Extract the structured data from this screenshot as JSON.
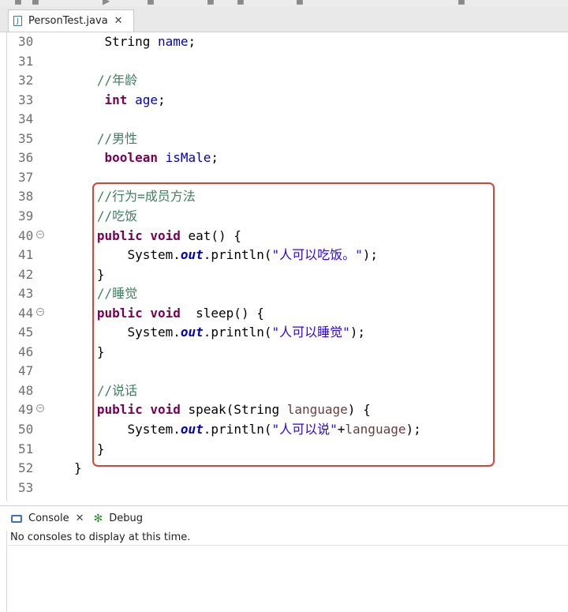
{
  "editor": {
    "tab": {
      "title": "PersonTest.java",
      "close": "✕"
    },
    "lines": [
      {
        "num": "30",
        "fold": false,
        "indent": "    ",
        "tokens": [
          {
            "t": "String "
          },
          {
            "t": "name",
            "c": "id"
          },
          {
            "t": ";"
          }
        ]
      },
      {
        "num": "31",
        "fold": false,
        "indent": "",
        "tokens": []
      },
      {
        "num": "32",
        "fold": false,
        "indent": "   ",
        "tokens": [
          {
            "t": "//年龄",
            "c": "cm"
          }
        ]
      },
      {
        "num": "33",
        "fold": false,
        "indent": "    ",
        "tokens": [
          {
            "t": "int",
            "c": "kw"
          },
          {
            "t": " "
          },
          {
            "t": "age",
            "c": "id"
          },
          {
            "t": ";"
          }
        ]
      },
      {
        "num": "34",
        "fold": false,
        "indent": "",
        "tokens": []
      },
      {
        "num": "35",
        "fold": false,
        "indent": "   ",
        "tokens": [
          {
            "t": "//男性",
            "c": "cm"
          }
        ]
      },
      {
        "num": "36",
        "fold": false,
        "indent": "    ",
        "tokens": [
          {
            "t": "boolean",
            "c": "kw"
          },
          {
            "t": " "
          },
          {
            "t": "isMale",
            "c": "id"
          },
          {
            "t": ";"
          }
        ]
      },
      {
        "num": "37",
        "fold": false,
        "indent": "",
        "tokens": []
      },
      {
        "num": "38",
        "fold": false,
        "indent": "   ",
        "tokens": [
          {
            "t": "//行为=成员方法",
            "c": "cm"
          }
        ]
      },
      {
        "num": "39",
        "fold": false,
        "indent": "   ",
        "tokens": [
          {
            "t": "//吃饭",
            "c": "cm"
          }
        ]
      },
      {
        "num": "40",
        "fold": true,
        "indent": "   ",
        "tokens": [
          {
            "t": "public",
            "c": "kw"
          },
          {
            "t": " "
          },
          {
            "t": "void",
            "c": "kw"
          },
          {
            "t": " eat() {"
          }
        ]
      },
      {
        "num": "41",
        "fold": false,
        "indent": "       ",
        "tokens": [
          {
            "t": "System."
          },
          {
            "t": "out",
            "c": "it"
          },
          {
            "t": ".println("
          },
          {
            "t": "\"人可以吃饭。\"",
            "c": "st"
          },
          {
            "t": ");"
          }
        ]
      },
      {
        "num": "42",
        "fold": false,
        "indent": "   ",
        "tokens": [
          {
            "t": "}"
          }
        ]
      },
      {
        "num": "43",
        "fold": false,
        "indent": "   ",
        "tokens": [
          {
            "t": "//睡觉",
            "c": "cm"
          }
        ]
      },
      {
        "num": "44",
        "fold": true,
        "indent": "   ",
        "tokens": [
          {
            "t": "public",
            "c": "kw"
          },
          {
            "t": " "
          },
          {
            "t": "void",
            "c": "kw"
          },
          {
            "t": "  sleep() {"
          }
        ]
      },
      {
        "num": "45",
        "fold": false,
        "indent": "       ",
        "tokens": [
          {
            "t": "System."
          },
          {
            "t": "out",
            "c": "it"
          },
          {
            "t": ".println("
          },
          {
            "t": "\"人可以睡觉\"",
            "c": "st"
          },
          {
            "t": ");"
          }
        ]
      },
      {
        "num": "46",
        "fold": false,
        "indent": "   ",
        "tokens": [
          {
            "t": "}"
          }
        ]
      },
      {
        "num": "47",
        "fold": false,
        "indent": "",
        "tokens": []
      },
      {
        "num": "48",
        "fold": false,
        "indent": "   ",
        "tokens": [
          {
            "t": "//说话",
            "c": "cm"
          }
        ]
      },
      {
        "num": "49",
        "fold": true,
        "indent": "   ",
        "tokens": [
          {
            "t": "public",
            "c": "kw"
          },
          {
            "t": " "
          },
          {
            "t": "void",
            "c": "kw"
          },
          {
            "t": " speak(String "
          },
          {
            "t": "language",
            "c": "pm"
          },
          {
            "t": ") {"
          }
        ]
      },
      {
        "num": "50",
        "fold": false,
        "indent": "       ",
        "tokens": [
          {
            "t": "System."
          },
          {
            "t": "out",
            "c": "it"
          },
          {
            "t": ".println("
          },
          {
            "t": "\"人可以说\"",
            "c": "st"
          },
          {
            "t": "+"
          },
          {
            "t": "language",
            "c": "pm"
          },
          {
            "t": ");"
          }
        ]
      },
      {
        "num": "51",
        "fold": false,
        "indent": "   ",
        "tokens": [
          {
            "t": "}"
          }
        ]
      },
      {
        "num": "52",
        "fold": false,
        "indent": "",
        "tokens": [
          {
            "t": "}"
          }
        ]
      },
      {
        "num": "53",
        "fold": false,
        "indent": "",
        "tokens": []
      }
    ]
  },
  "views": {
    "console_tab": {
      "label": "Console",
      "close": "✕"
    },
    "debug_tab": {
      "label": "Debug"
    },
    "console_message": "No consoles to display at this time."
  },
  "colors": {
    "keyword": "#7a0055",
    "field": "#0000c0",
    "comment": "#3f7f5f",
    "string": "#2a00ff",
    "highlight_border": "#e0412f"
  },
  "icons": {
    "editor_tab": "java-file-icon",
    "console_tab": "console-icon",
    "debug_tab": "bug-icon",
    "fold": "collapse-minus-icon"
  }
}
